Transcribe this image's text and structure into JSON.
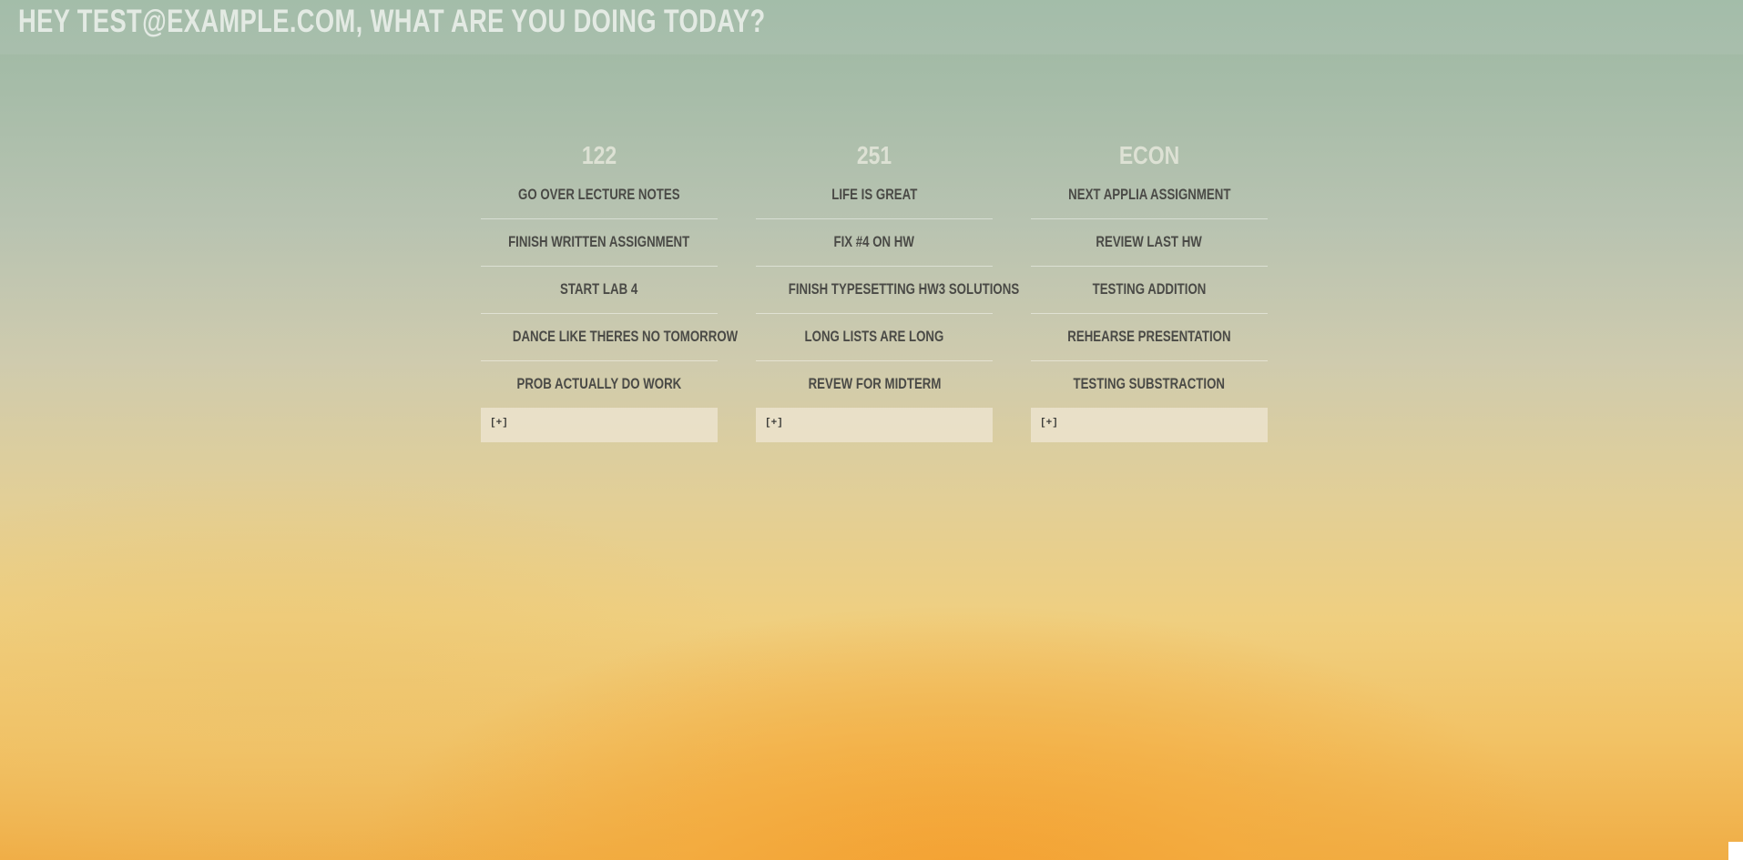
{
  "header": {
    "greeting": "HEY TEST@EXAMPLE.COM, WHAT ARE YOU DOING TODAY?"
  },
  "columns": [
    {
      "title": "122",
      "items": [
        "GO OVER LECTURE NOTES",
        "FINISH WRITTEN ASSIGNMENT",
        "START LAB 4",
        "DANCE LIKE THERES NO TOMORROW",
        "PROB ACTUALLY DO WORK"
      ],
      "add_label": "[+]"
    },
    {
      "title": "251",
      "items": [
        "LIFE IS GREAT",
        "FIX #4 ON HW",
        "FINISH TYPESETTING HW3 SOLUTIONS",
        "LONG LISTS ARE LONG",
        "REVEW FOR MIDTERM"
      ],
      "add_label": "[+]"
    },
    {
      "title": "ECON",
      "items": [
        "NEXT APPLIA ASSIGNMENT",
        "REVIEW LAST HW",
        "TESTING ADDITION",
        "REHEARSE PRESENTATION",
        "TESTING SUBSTRACTION"
      ],
      "add_label": "[+]"
    }
  ]
}
